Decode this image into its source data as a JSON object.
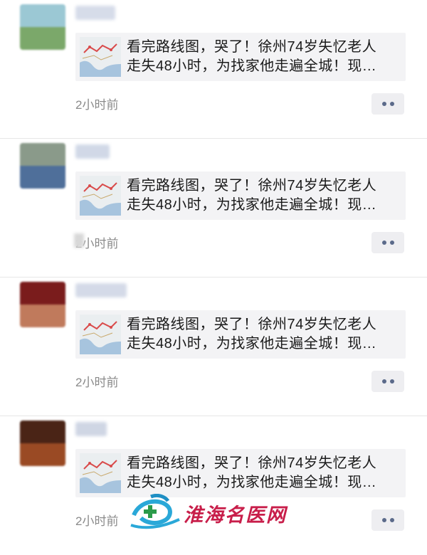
{
  "feed": {
    "posts": [
      {
        "card_line1": "看完路线图，哭了！徐州74岁失忆老人",
        "card_line2": "走失48小时，为找家他走遍全城！现…",
        "time": "2小时前",
        "avatar_colors": [
          "#9bc8d4",
          "#7ba86a"
        ],
        "name_color": "#cfd6e6",
        "name_width": 56
      },
      {
        "card_line1": "看完路线图，哭了！徐州74岁失忆老人",
        "card_line2": "走失48小时，为找家他走遍全城！现…",
        "time": "2小时前",
        "avatar_colors": [
          "#8a9a8a",
          "#4f6f9a"
        ],
        "name_color": "#c9d2e3",
        "name_width": 48,
        "time_obscured": true
      },
      {
        "card_line1": "看完路线图，哭了！徐州74岁失忆老人",
        "card_line2": "走失48小时，为找家他走遍全城！现…",
        "time": "2小时前",
        "avatar_colors": [
          "#7a1c1c",
          "#c07a5c"
        ],
        "name_color": "#cdd4e4",
        "name_width": 72
      },
      {
        "card_line1": "看完路线图，哭了！徐州74岁失忆老人",
        "card_line2": "走失48小时，为找家他走遍全城！现…",
        "time": "2小时前",
        "avatar_colors": [
          "#4a2416",
          "#9a4a24"
        ],
        "name_color": "#c7cfe0",
        "name_width": 44
      }
    ]
  },
  "icons": {
    "more": "more-dots-icon",
    "thumbnail": "map-route-thumbnail"
  },
  "watermark": {
    "text": "淮海名医网",
    "color": "#c81e4a",
    "logo_color": "#2aa8d8"
  }
}
